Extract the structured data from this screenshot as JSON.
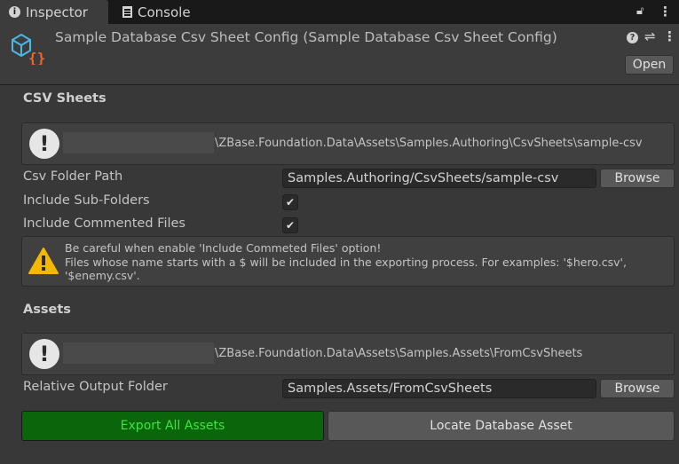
{
  "tabs": [
    {
      "label": "Inspector",
      "icon": "info-icon"
    },
    {
      "label": "Console",
      "icon": "console-icon"
    }
  ],
  "header": {
    "title": "Sample Database Csv Sheet Config (Sample Database Csv Sheet Config)",
    "open_label": "Open"
  },
  "csv": {
    "heading": "CSV Sheets",
    "path_info": "\\ZBase.Foundation.Data\\Assets\\Samples.Authoring\\CsvSheets\\sample-csv",
    "folder_label": "Csv Folder Path",
    "folder_value": "Samples.Authoring/CsvSheets/sample-csv",
    "browse": "Browse",
    "sub_label": "Include Sub-Folders",
    "sub_checked": true,
    "commented_label": "Include Commented Files",
    "commented_checked": true,
    "warning": [
      "Be careful when enable 'Include Commeted Files' option!",
      "Files whose name starts with a $ will be included in the exporting process. For examples: '$hero.csv', '$enemy.csv'."
    ]
  },
  "assets": {
    "heading": "Assets",
    "path_info": "\\ZBase.Foundation.Data\\Assets\\Samples.Assets\\FromCsvSheets",
    "output_label": "Relative Output Folder",
    "output_value": "Samples.Assets/FromCsvSheets",
    "browse": "Browse"
  },
  "actions": {
    "export": "Export All Assets",
    "locate": "Locate Database Asset"
  },
  "colors": {
    "export_bg": "#0b660b",
    "export_text": "#39e639",
    "warning": "#f5b800",
    "icon_blue": "#4ab8e6",
    "icon_orange": "#f0642a"
  }
}
